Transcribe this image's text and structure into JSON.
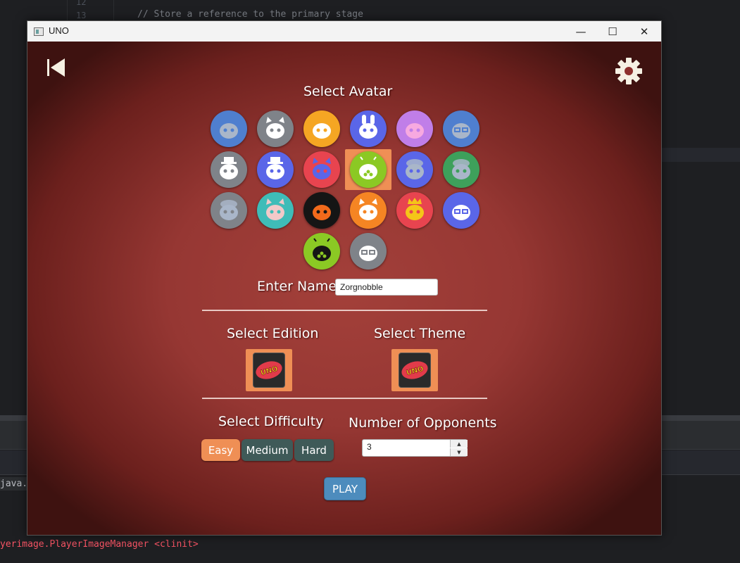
{
  "ide": {
    "line_numbers": [
      "12",
      "13"
    ],
    "comment_line": "// Store a reference to the primary stage",
    "java_tab": "java.",
    "error_text": "yerimage.PlayerImageManager <clinit>"
  },
  "window": {
    "title": "UNO",
    "minimize_glyph": "—",
    "maximize_glyph": "☐",
    "close_glyph": "✕"
  },
  "header": {
    "back_icon": "skip-back-icon",
    "settings_icon": "gear-icon"
  },
  "avatar_section": {
    "heading": "Select Avatar",
    "selected_index": 9,
    "avatars": [
      {
        "bg": "#4f7fcf",
        "fg": "#a9b6c9",
        "kind": "blob"
      },
      {
        "bg": "#7f8389",
        "fg": "#ffffff",
        "kind": "cat"
      },
      {
        "bg": "#f5a623",
        "fg": "#ffffff",
        "kind": "blob"
      },
      {
        "bg": "#5a66e8",
        "fg": "#ffffff",
        "kind": "bunny"
      },
      {
        "bg": "#c07ee8",
        "fg": "#f7a9e0",
        "kind": "blob"
      },
      {
        "bg": "#4f7fcf",
        "fg": "#a9b6c9",
        "kind": "glasses"
      },
      {
        "bg": "#7f8389",
        "fg": "#ffffff",
        "kind": "hat"
      },
      {
        "bg": "#5a66e8",
        "fg": "#ffffff",
        "kind": "hat"
      },
      {
        "bg": "#e8444f",
        "fg": "#5a66e8",
        "kind": "cat"
      },
      {
        "bg": "#8bc924",
        "fg": "#ffffff",
        "kind": "android"
      },
      {
        "bg": "#5a66e8",
        "fg": "#a9b6c9",
        "kind": "beanie"
      },
      {
        "bg": "#3ea05b",
        "fg": "#a9b6c9",
        "kind": "beanie"
      },
      {
        "bg": "#7f8389",
        "fg": "#a9b6c9",
        "kind": "beanie"
      },
      {
        "bg": "#3fbcb8",
        "fg": "#f2c9c9",
        "kind": "cat"
      },
      {
        "bg": "#151515",
        "fg": "#f26a1b",
        "kind": "blob"
      },
      {
        "bg": "#f58523",
        "fg": "#ffffff",
        "kind": "cat"
      },
      {
        "bg": "#e8444f",
        "fg": "#f5c518",
        "kind": "crown"
      },
      {
        "bg": "#5a66e8",
        "fg": "#ffffff",
        "kind": "glasses"
      },
      {
        "bg": "#8bc924",
        "fg": "#151515",
        "kind": "android"
      },
      {
        "bg": "#7f8389",
        "fg": "#ffffff",
        "kind": "glasses"
      }
    ]
  },
  "name_section": {
    "label": "Enter Name",
    "value": "Zorgnobble"
  },
  "edition_section": {
    "heading": "Select Edition",
    "card_logo": "UNO"
  },
  "theme_section": {
    "heading": "Select Theme",
    "card_logo": "UNO"
  },
  "difficulty_section": {
    "heading": "Select Difficulty",
    "options": [
      "Easy",
      "Medium",
      "Hard"
    ],
    "selected": "Easy"
  },
  "opponents_section": {
    "heading": "Number of Opponents",
    "value": "3"
  },
  "play_button": "PLAY",
  "colors": {
    "accent": "#ef8f55",
    "button_dark": "#3f5a58",
    "play": "#4d8cbd",
    "background": "#963733"
  }
}
